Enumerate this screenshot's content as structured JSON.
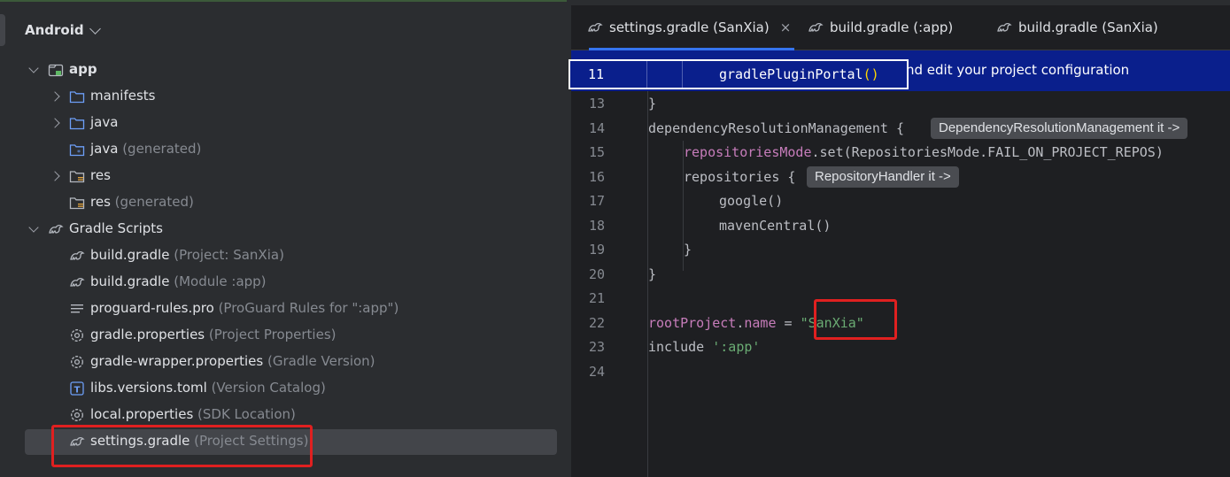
{
  "project_panel": {
    "view_selector": "Android",
    "tree": [
      {
        "main": "app",
        "hint": "",
        "icon": "module-folder-icon",
        "arrow": "down"
      },
      {
        "main": "manifests",
        "hint": "",
        "icon": "folder-icon",
        "arrow": "right"
      },
      {
        "main": "java",
        "hint": "",
        "icon": "folder-icon",
        "arrow": "right"
      },
      {
        "main": "java",
        "hint": " (generated)",
        "icon": "generated-folder-icon",
        "arrow": ""
      },
      {
        "main": "res",
        "hint": "",
        "icon": "resource-folder-icon",
        "arrow": "right"
      },
      {
        "main": "res",
        "hint": " (generated)",
        "icon": "resource-folder-icon",
        "arrow": ""
      },
      {
        "main": "Gradle Scripts",
        "hint": "",
        "icon": "gradle-icon",
        "arrow": "down"
      },
      {
        "main": "build.gradle",
        "hint": " (Project: SanXia)",
        "icon": "gradle-icon",
        "arrow": ""
      },
      {
        "main": "build.gradle",
        "hint": " (Module :app)",
        "icon": "gradle-icon",
        "arrow": ""
      },
      {
        "main": "proguard-rules.pro",
        "hint": " (ProGuard Rules for \":app\")",
        "icon": "text-file-icon",
        "arrow": ""
      },
      {
        "main": "gradle.properties",
        "hint": " (Project Properties)",
        "icon": "settings-gear-icon",
        "arrow": ""
      },
      {
        "main": "gradle-wrapper.properties",
        "hint": " (Gradle Version)",
        "icon": "settings-gear-icon",
        "arrow": ""
      },
      {
        "main": "libs.versions.toml",
        "hint": " (Version Catalog)",
        "icon": "toml-file-icon",
        "arrow": ""
      },
      {
        "main": "local.properties",
        "hint": " (SDK Location)",
        "icon": "settings-gear-icon",
        "arrow": ""
      },
      {
        "main": "settings.gradle",
        "hint": " (Project Settings)",
        "icon": "gradle-icon",
        "arrow": "",
        "selected": true
      }
    ]
  },
  "editor": {
    "tabs": [
      {
        "label": "settings.gradle (SanXia)",
        "active": true,
        "close": "×"
      },
      {
        "label": "build.gradle (:app)",
        "active": false
      },
      {
        "label": "build.gradle (SanXia)",
        "active": false
      }
    ],
    "banner_text": "nd edit your project configuration",
    "sticky_line": {
      "num": "11",
      "code": "gradlePluginPortal",
      "parens": "()"
    },
    "lines": [
      {
        "num": "13",
        "text": "}"
      },
      {
        "num": "14",
        "text": "dependencyResolutionManagement {",
        "hint": "DependencyResolutionManagement it ->"
      },
      {
        "num": "15",
        "prop": "repositoriesMode",
        "text": ".set(RepositoriesMode.FAIL_ON_PROJECT_REPOS)"
      },
      {
        "num": "16",
        "text": "repositories {",
        "hint": "RepositoryHandler it ->"
      },
      {
        "num": "17",
        "text": "google()"
      },
      {
        "num": "18",
        "text": "mavenCentral()"
      },
      {
        "num": "19",
        "text": "}"
      },
      {
        "num": "20",
        "text": "}"
      },
      {
        "num": "21",
        "text": ""
      },
      {
        "num": "22",
        "prop": "rootProject",
        "text": ".",
        "prop2": "name",
        "text2": " = ",
        "str": "\"SanXia\""
      },
      {
        "num": "23",
        "text": "include ",
        "str": "':app'"
      },
      {
        "num": "24",
        "text": ""
      }
    ]
  },
  "colors": {
    "accent": "#3574f0",
    "highlight_box": "#e02020",
    "banner": "#0a1f8c",
    "string": "#6aab73",
    "property": "#c77dbb"
  }
}
